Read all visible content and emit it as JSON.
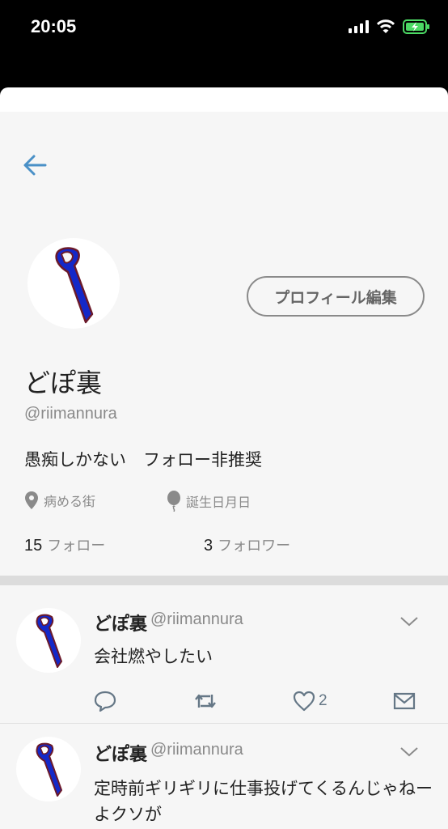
{
  "status_bar": {
    "time": "20:05"
  },
  "profile": {
    "edit_button": "プロフィール編集",
    "display_name": "どぽ裏",
    "handle": "@riimannura",
    "bio": "愚痴しかない　フォロー非推奨",
    "location": "病める街",
    "birthday": "誕生日月日",
    "following_count": "15",
    "following_label": "フォロー",
    "followers_count": "3",
    "followers_label": "フォロワー"
  },
  "tweets": [
    {
      "name": "どぽ裏",
      "handle": "@riimannura",
      "text": "会社燃やしたい",
      "likes": "2"
    },
    {
      "name": "どぽ裏",
      "handle": "@riimannura",
      "text": "定時前ギリギリに仕事投げてくるんじゃねーよクソが"
    }
  ],
  "icons": {
    "back": "arrow-left-icon",
    "location": "location-pin-icon",
    "birthday": "balloon-icon",
    "reply": "reply-icon",
    "retweet": "retweet-icon",
    "like": "heart-icon",
    "dm": "envelope-icon",
    "more": "chevron-down-icon"
  },
  "colors": {
    "accent": "#4a90c7",
    "icon_gray": "#657786",
    "tie_blue": "#1428c8",
    "tie_outline": "#6b1a2a"
  }
}
